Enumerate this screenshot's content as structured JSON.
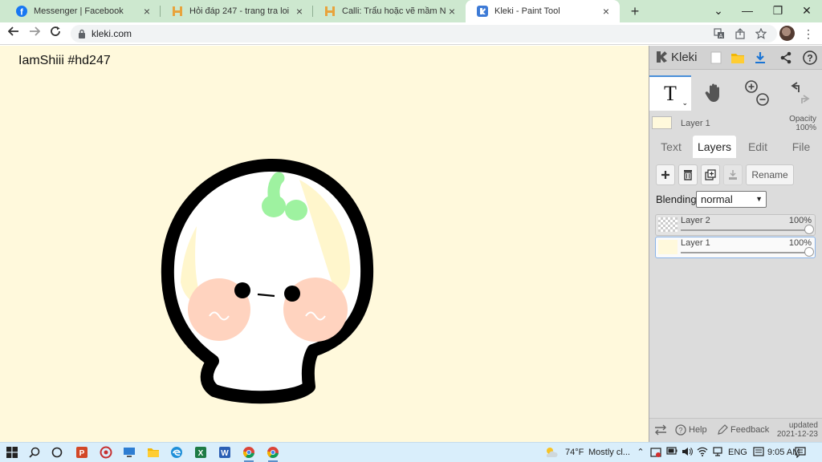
{
  "browser": {
    "tabs": [
      {
        "title": "Messenger | Facebook",
        "close": "×"
      },
      {
        "title": "Hỏi đáp 247 - trang tra loi",
        "close": "×"
      },
      {
        "title": "Calli: Trẩu hoặc vẽ mầm NL: Hoid",
        "close": "×"
      },
      {
        "title": "Kleki - Paint Tool",
        "close": "×"
      }
    ],
    "new_tab": "+",
    "window_controls": {
      "dropdown": "⌄",
      "minimize": "—",
      "restore": "❐",
      "close": "✕"
    },
    "url": "kleki.com"
  },
  "canvas": {
    "text": "IamShiii #hd247",
    "background_color": "#fff9dc"
  },
  "kleki": {
    "logo": "Kleki",
    "tabs": [
      "Text",
      "Layers",
      "Edit",
      "File"
    ],
    "active_tab": "Layers",
    "current_layer": "Layer 1",
    "opacity_label": "Opacity",
    "opacity_value": "100%",
    "rename": "Rename",
    "blending_label": "Blending",
    "blending_value": "normal",
    "layers": [
      {
        "name": "Layer 2",
        "opacity": "100%",
        "opacity_value": 1.0
      },
      {
        "name": "Layer 1",
        "opacity": "100%",
        "opacity_value": 1.0
      }
    ],
    "footer": {
      "help": "Help",
      "feedback": "Feedback",
      "updated_label": "updated",
      "updated_date": "2021-12-23"
    }
  },
  "taskbar": {
    "weather_temp": "74°F",
    "weather_text": "Mostly cl...",
    "language": "ENG",
    "time": "9:05 AM"
  }
}
